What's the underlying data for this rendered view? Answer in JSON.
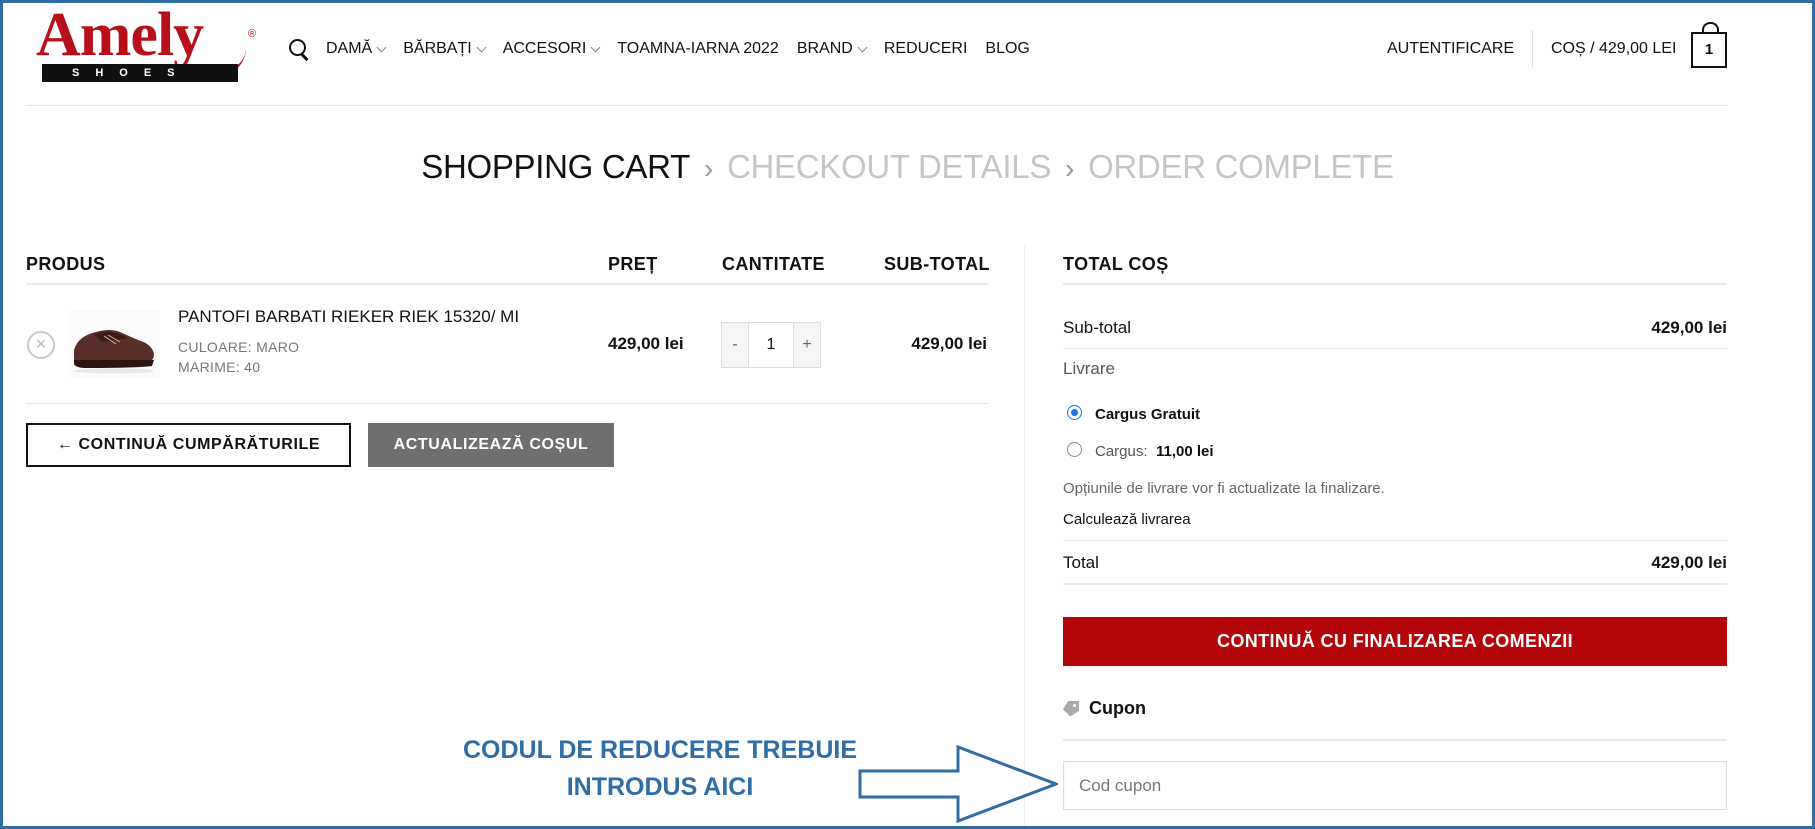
{
  "header": {
    "logo_text": "Amely",
    "logo_sub": "SHOES",
    "logo_reg": "®",
    "nav": [
      {
        "label": "DAMĂ",
        "has_dropdown": true
      },
      {
        "label": "BĂRBAȚI",
        "has_dropdown": true
      },
      {
        "label": "ACCESORI",
        "has_dropdown": true
      },
      {
        "label": "TOAMNA-IARNA 2022",
        "has_dropdown": false
      },
      {
        "label": "BRAND",
        "has_dropdown": true
      },
      {
        "label": "REDUCERI",
        "has_dropdown": false
      },
      {
        "label": "BLOG",
        "has_dropdown": false
      }
    ],
    "login_label": "AUTENTIFICARE",
    "cart_label": "COȘ / 429,00 LEI",
    "cart_count": "1"
  },
  "breadcrumb": {
    "step1": "SHOPPING CART",
    "step2": "CHECKOUT DETAILS",
    "step3": "ORDER COMPLETE",
    "separator": "›"
  },
  "cart": {
    "headers": {
      "product": "PRODUS",
      "price": "PREȚ",
      "quantity": "CANTITATE",
      "subtotal": "SUB-TOTAL"
    },
    "items": [
      {
        "name": "PANTOFI BARBATI RIEKER RIEK 15320/ MI",
        "color": "CULOARE:  MARO",
        "size": "MARIME:  40",
        "price": "429,00 lei",
        "qty": "1",
        "subtotal": "429,00 lei"
      }
    ],
    "remove_symbol": "×",
    "qty_minus": "-",
    "qty_plus": "+",
    "continue_label": "← CONTINUĂ CUMPĂRĂTURILE",
    "update_label": "ACTUALIZEAZĂ COȘUL"
  },
  "totals": {
    "title": "TOTAL COȘ",
    "subtotal_label": "Sub-total",
    "subtotal_value": "429,00 lei",
    "shipping_label": "Livrare",
    "shipping_options": [
      {
        "label": "Cargus Gratuit",
        "price": "",
        "selected": true
      },
      {
        "label": "Cargus:",
        "price": "11,00 lei",
        "selected": false
      }
    ],
    "shipping_note": "Opțiunile de livrare vor fi actualizate la finalizare.",
    "calc_label": "Calculează livrarea",
    "total_label": "Total",
    "total_value": "429,00 lei",
    "checkout_label": "CONTINUĂ CU FINALIZAREA COMENZII",
    "coupon_title": "Cupon",
    "coupon_placeholder": "Cod cupon"
  },
  "annotation": {
    "line1": "CODUL DE REDUCERE TREBUIE",
    "line2": "INTRODUS AICI"
  },
  "colors": {
    "brand_red": "#b3050a",
    "annotation_blue": "#2e6ea4",
    "radio_blue": "#1a73e8"
  }
}
